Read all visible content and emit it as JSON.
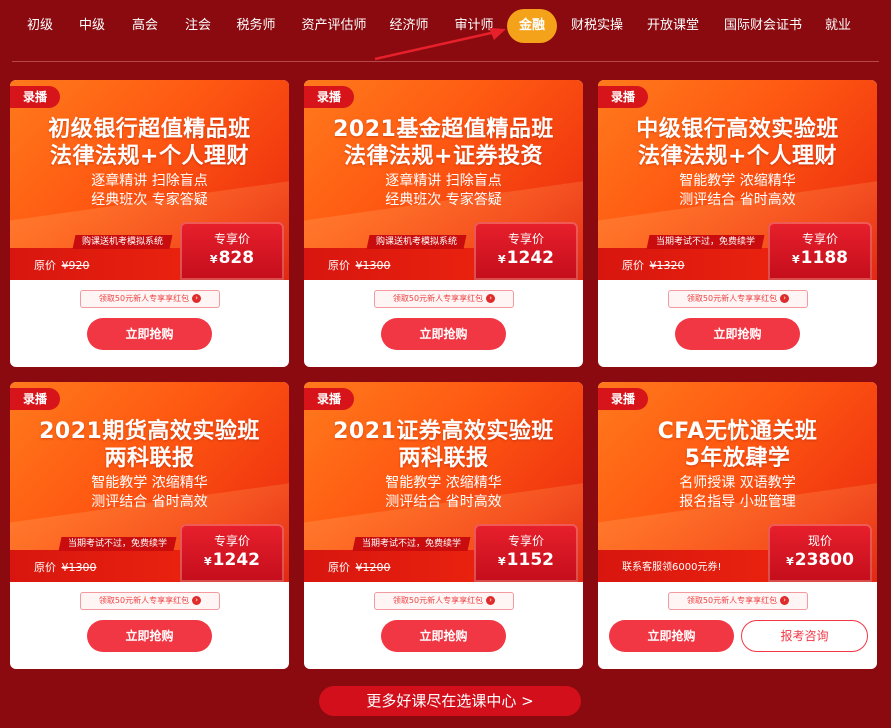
{
  "nav": {
    "tabs": [
      {
        "label": "初级"
      },
      {
        "label": "中级"
      },
      {
        "label": "高会"
      },
      {
        "label": "注会"
      },
      {
        "label": "税务师"
      },
      {
        "label": "资产评估师"
      },
      {
        "label": "经济师"
      },
      {
        "label": "审计师"
      },
      {
        "label": "金融",
        "active": true
      },
      {
        "label": "财税实操"
      },
      {
        "label": "开放课堂"
      },
      {
        "label": "国际财会证书"
      },
      {
        "label": "就业"
      }
    ]
  },
  "colors": {
    "page_bg": "#8a0a10",
    "active_tab": "#f5a21b",
    "accent": "#f23744"
  },
  "cards": [
    {
      "tag": "录播",
      "title1": "初级银行超值精品班",
      "title2": "法律法规+个人理财",
      "sub1": "逐章精讲 扫除盲点",
      "sub2": "经典班次 专家答疑",
      "promo": "购课送机考模拟系统",
      "orig_label": "原价",
      "orig_price": "¥920",
      "price_label": "专享价",
      "currency": "¥",
      "price": "828",
      "coupon": "领取50元新人专享享红包",
      "buy": "立即抢购"
    },
    {
      "tag": "录播",
      "title1": "2021基金超值精品班",
      "title2": "法律法规+证券投资",
      "sub1": "逐章精讲 扫除盲点",
      "sub2": "经典班次 专家答疑",
      "promo": "购课送机考模拟系统",
      "orig_label": "原价",
      "orig_price": "¥1300",
      "price_label": "专享价",
      "currency": "¥",
      "price": "1242",
      "coupon": "领取50元新人专享享红包",
      "buy": "立即抢购"
    },
    {
      "tag": "录播",
      "title1": "中级银行高效实验班",
      "title2": "法律法规+个人理财",
      "sub1": "智能教学 浓缩精华",
      "sub2": "测评结合 省时高效",
      "promo": "当期考试不过，免费续学",
      "orig_label": "原价",
      "orig_price": "¥1320",
      "price_label": "专享价",
      "currency": "¥",
      "price": "1188",
      "coupon": "领取50元新人专享享红包",
      "buy": "立即抢购"
    },
    {
      "tag": "录播",
      "title1": "2021期货高效实验班",
      "title2": "两科联报",
      "sub1": "智能教学 浓缩精华",
      "sub2": "测评结合 省时高效",
      "promo": "当期考试不过，免费续学",
      "orig_label": "原价",
      "orig_price": "¥1300",
      "price_label": "专享价",
      "currency": "¥",
      "price": "1242",
      "coupon": "领取50元新人专享享红包",
      "buy": "立即抢购"
    },
    {
      "tag": "录播",
      "title1": "2021证券高效实验班",
      "title2": "两科联报",
      "sub1": "智能教学 浓缩精华",
      "sub2": "测评结合 省时高效",
      "promo": "当期考试不过，免费续学",
      "orig_label": "原价",
      "orig_price": "¥1200",
      "price_label": "专享价",
      "currency": "¥",
      "price": "1152",
      "coupon": "领取50元新人专享享红包",
      "buy": "立即抢购"
    },
    {
      "tag": "录播",
      "title1": "CFA无忧通关班",
      "title2": "5年放肆学",
      "sub1": "名师授课 双语教学",
      "sub2": "报名指导 小班管理",
      "note": "联系客服领6000元券!",
      "price_label": "现价",
      "currency": "¥",
      "price": "23800",
      "coupon": "领取50元新人专享享红包",
      "buy": "立即抢购",
      "consult": "报考咨询"
    }
  ],
  "more": {
    "label": "更多好课尽在选课中心 >"
  }
}
